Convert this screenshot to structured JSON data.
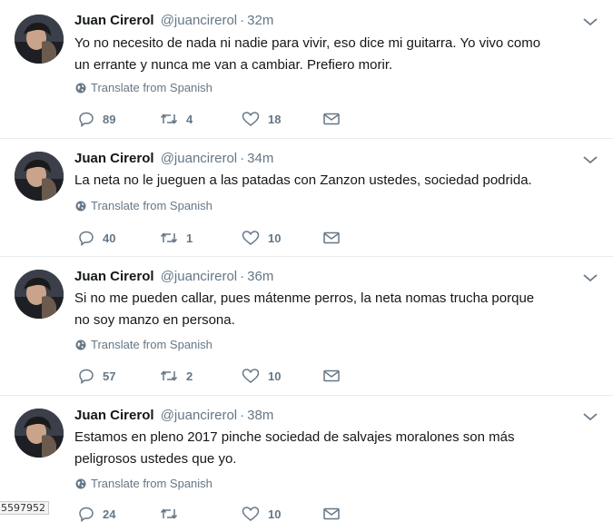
{
  "tweets": [
    {
      "name": "Juan Cirerol",
      "handle": "@juancirerol",
      "separator": "·",
      "time": "32m",
      "lines": [
        "Yo no necesito de nada ni nadie para vivir, eso dice mi guitarra. Yo vivo como",
        "un errante y nunca me van a cambiar. Prefiero morir."
      ],
      "translate": "Translate from Spanish",
      "replies": "89",
      "retweets": "4",
      "likes": "18"
    },
    {
      "name": "Juan Cirerol",
      "handle": "@juancirerol",
      "separator": "·",
      "time": "34m",
      "lines": [
        "La neta no le jueguen a las patadas con Zanzon ustedes, sociedad podrida."
      ],
      "translate": "Translate from Spanish",
      "replies": "40",
      "retweets": "1",
      "likes": "10"
    },
    {
      "name": "Juan Cirerol",
      "handle": "@juancirerol",
      "separator": "·",
      "time": "36m",
      "lines": [
        "Si no me pueden callar, pues mátenme perros, la neta nomas trucha porque",
        "no soy manzo en persona."
      ],
      "translate": "Translate from Spanish",
      "replies": "57",
      "retweets": "2",
      "likes": "10"
    },
    {
      "name": "Juan Cirerol",
      "handle": "@juancirerol",
      "separator": "·",
      "time": "38m",
      "lines": [
        "Estamos en pleno 2017 pinche sociedad de salvajes moralones son más",
        "peligrosos ustedes que yo."
      ],
      "translate": "Translate from Spanish",
      "replies": "24",
      "retweets": "",
      "likes": "10"
    }
  ],
  "corner_label": "5597952",
  "icons": {
    "reply": "reply-icon",
    "retweet": "retweet-icon",
    "like": "heart-icon",
    "dm": "envelope-icon",
    "globe": "globe-icon",
    "caret": "chevron-down-icon"
  },
  "colors": {
    "text": "#14171a",
    "secondary": "#657786",
    "divider": "#e6ecf0"
  }
}
